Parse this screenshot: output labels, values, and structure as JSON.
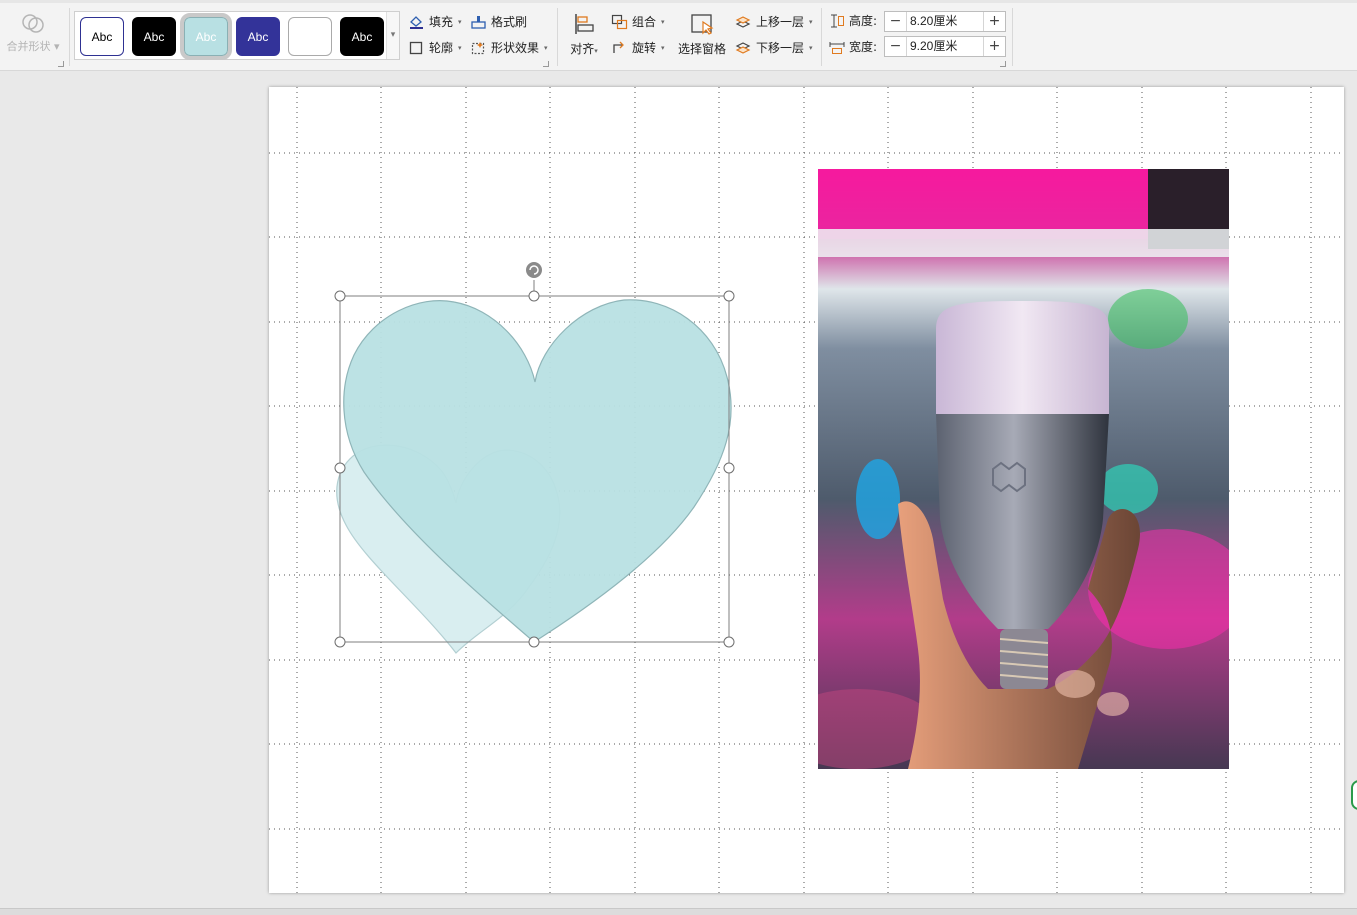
{
  "toolbar": {
    "merge_shapes_label": "合并形状",
    "style_gallery": [
      {
        "label": "Abc",
        "bg": "#ffffff",
        "fg": "#000000",
        "border": "#2e3192"
      },
      {
        "label": "Abc",
        "bg": "#000000",
        "fg": "#ffffff",
        "border": "#000000"
      },
      {
        "label": "Abc",
        "bg": "#b8e0e3",
        "fg": "#ffffff",
        "border": "#8ab0b4",
        "selected": true
      },
      {
        "label": "Abc",
        "bg": "#333399",
        "fg": "#ffffff",
        "border": "#2e3192"
      },
      {
        "label": "",
        "bg": "#ffffff",
        "fg": "#000000",
        "border": "#999999"
      },
      {
        "label": "Abc",
        "bg": "#000000",
        "fg": "#ffffff",
        "border": "#000000"
      }
    ],
    "fill_label": "填充",
    "format_painter_label": "格式刷",
    "outline_label": "轮廓",
    "shape_effects_label": "形状效果",
    "align_label": "对齐",
    "group_label": "组合",
    "rotate_label": "旋转",
    "selection_pane_label": "选择窗格",
    "bring_forward_label": "上移一层",
    "send_backward_label": "下移一层",
    "height_label": "高度:",
    "height_value": "8.20厘米",
    "width_label": "宽度:",
    "width_value": "9.20厘米",
    "minus": "−",
    "plus": "+"
  },
  "colors": {
    "heart_fill": "#b8e0e3",
    "heart_back_fill": "#d9eef0",
    "heart_stroke": "#8fb5b8",
    "accent_orange": "#e07a1f",
    "accent_blue": "#2e5fb0"
  },
  "slide": {
    "selected_shape": "heart",
    "image": "hand-holding-smart-bulb-photo"
  }
}
